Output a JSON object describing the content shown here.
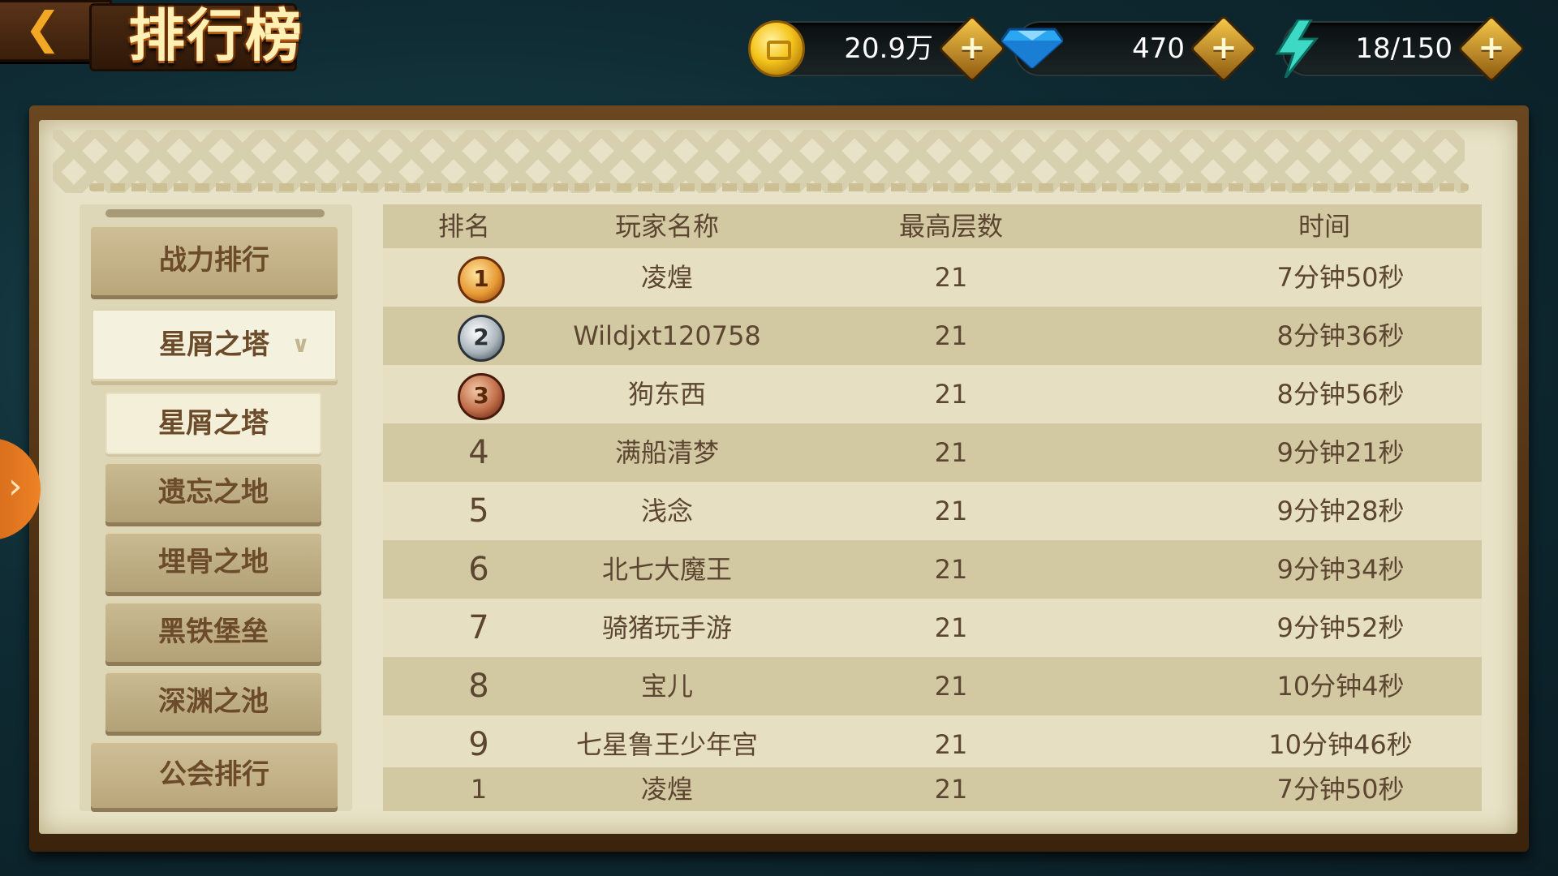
{
  "header": {
    "back_icon": "chevron-left-icon",
    "title": "排行榜"
  },
  "resources": {
    "gold": {
      "icon": "gold-coin-icon",
      "value": "20.9万",
      "add": "+"
    },
    "diamond": {
      "icon": "diamond-icon",
      "value": "470",
      "add": "+"
    },
    "energy": {
      "icon": "lightning-icon",
      "value": "18/150",
      "add": "+"
    }
  },
  "sidebar": {
    "power_rank": "战力排行",
    "tower_group": "星屑之塔",
    "tower_group_icon": "chevron-down-icon",
    "sub_items": [
      "星屑之塔",
      "遗忘之地",
      "埋骨之地",
      "黑铁堡垒",
      "深渊之池"
    ],
    "guild_rank": "公会排行"
  },
  "table": {
    "headers": {
      "rank": "排名",
      "name": "玩家名称",
      "floor": "最高层数",
      "time": "时间"
    },
    "rows": [
      {
        "rank": "1",
        "medal": "gold-medal-icon",
        "name": "凌煌",
        "floor": "21",
        "time": "7分钟50秒"
      },
      {
        "rank": "2",
        "medal": "silver-medal-icon",
        "name": "Wildjxt120758",
        "floor": "21",
        "time": "8分钟36秒"
      },
      {
        "rank": "3",
        "medal": "bronze-medal-icon",
        "name": "狗东西",
        "floor": "21",
        "time": "8分钟56秒"
      },
      {
        "rank": "4",
        "name": "满船清梦",
        "floor": "21",
        "time": "9分钟21秒"
      },
      {
        "rank": "5",
        "name": "浅念",
        "floor": "21",
        "time": "9分钟28秒"
      },
      {
        "rank": "6",
        "name": "北七大魔王",
        "floor": "21",
        "time": "9分钟34秒"
      },
      {
        "rank": "7",
        "name": "骑猪玩手游",
        "floor": "21",
        "time": "9分钟52秒"
      },
      {
        "rank": "8",
        "name": "宝儿",
        "floor": "21",
        "time": "10分钟4秒"
      },
      {
        "rank": "9",
        "name": "七星鲁王少年宫",
        "floor": "21",
        "time": "10分钟46秒"
      }
    ],
    "self_row": {
      "rank": "1",
      "name": "凌煌",
      "floor": "21",
      "time": "7分钟50秒"
    }
  },
  "side_tab": {
    "icon": "chevron-right-icon"
  }
}
